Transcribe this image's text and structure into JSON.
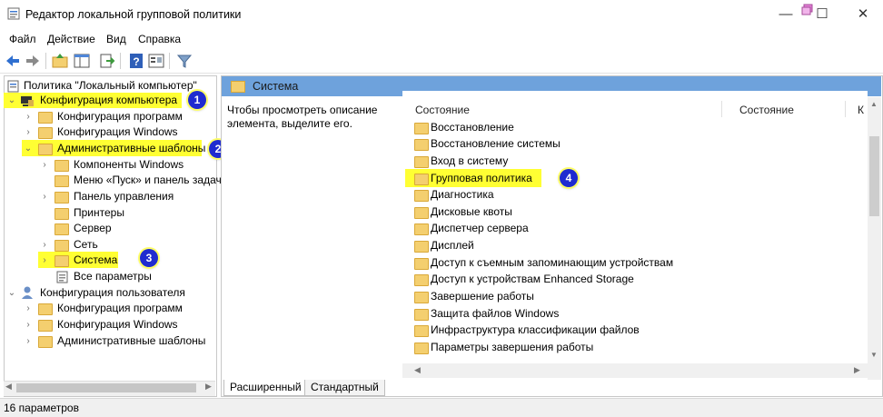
{
  "window": {
    "title": "Редактор локальной групповой политики",
    "minimize": "—",
    "maximize": "☐",
    "close": "✕"
  },
  "menu": [
    "Файл",
    "Действие",
    "Вид",
    "Справка"
  ],
  "toolbar": [
    "back-icon",
    "forward-icon",
    "up-folder-icon",
    "show-tree-icon",
    "export-icon",
    "help-icon",
    "properties-icon",
    "filter-icon"
  ],
  "tree": {
    "root": "Политика \"Локальный компьютер\"",
    "computer_config": "Конфигурация компьютера",
    "cc_programs": "Конфигурация программ",
    "cc_windows": "Конфигурация Windows",
    "admin_templates": "Административные шаблоны",
    "windows_components": "Компоненты Windows",
    "start_menu": "Меню «Пуск» и панель задач",
    "control_panel": "Панель управления",
    "printers": "Принтеры",
    "server": "Сервер",
    "network": "Сеть",
    "system": "Система",
    "all_settings": "Все параметры",
    "user_config": "Конфигурация пользователя",
    "uc_programs": "Конфигурация программ",
    "uc_windows": "Конфигурация Windows",
    "uc_admin": "Административные шаблоны"
  },
  "badges": [
    "1",
    "2",
    "3",
    "4"
  ],
  "right": {
    "header": "Система",
    "description": "Чтобы просмотреть описание элемента, выделите его.",
    "col_state": "Состояние",
    "col_state2": "Состояние",
    "col_more": "К"
  },
  "items": [
    "Восстановление",
    "Восстановление системы",
    "Вход в систему",
    "Групповая политика",
    "Диагностика",
    "Дисковые квоты",
    "Диспетчер сервера",
    "Дисплей",
    "Доступ к съемным запоминающим устройствам",
    "Доступ к устройствам Enhanced Storage",
    "Завершение работы",
    "Защита файлов Windows",
    "Инфраструктура классификации файлов",
    "Параметры завершения работы"
  ],
  "tabs": [
    "Расширенный",
    "Стандартный"
  ],
  "status": "16 параметров",
  "colors": {
    "highlight": "#ffff33",
    "badge": "#1f2bd0",
    "header": "#6ea2dc",
    "folder": "#f4cf6f"
  }
}
